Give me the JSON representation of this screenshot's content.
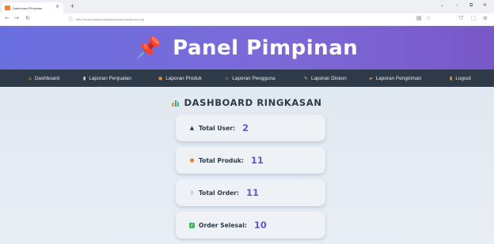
{
  "browser": {
    "tab_title": "Dashboard Pimpinan",
    "tab_close": "×",
    "new_tab": "+",
    "url": "http://localhost/riverakit/pimpinan/dashboard.php",
    "window_controls": [
      "⌄",
      "–",
      "⧉",
      "✕"
    ]
  },
  "header": {
    "title": "Panel Pimpinan",
    "pin_icon": "📌"
  },
  "navbar": {
    "items": [
      {
        "label": "Dashboard",
        "icon": "home-icon",
        "color": "#e0a93a"
      },
      {
        "label": "Laporan Penjualan",
        "icon": "document-icon",
        "color": "#d8dde3"
      },
      {
        "label": "Laporan Produk",
        "icon": "box-icon",
        "color": "#e08a3a"
      },
      {
        "label": "Laporan Pengguna",
        "icon": "users-icon",
        "color": "#4a5568"
      },
      {
        "label": "Laporan Diskon",
        "icon": "tag-icon",
        "color": "#e8c84a"
      },
      {
        "label": "Laporan Pengiriman",
        "icon": "truck-icon",
        "color": "#e08a3a"
      },
      {
        "label": "Logout",
        "icon": "door-icon",
        "color": "#e0a93a"
      }
    ]
  },
  "dashboard": {
    "title": "DASHBOARD RINGKASAN",
    "cards": [
      {
        "label": "Total User:",
        "value": "2",
        "icon": "user-icon"
      },
      {
        "label": "Total Produk:",
        "value": "11",
        "icon": "cookie-icon"
      },
      {
        "label": "Total Order:",
        "value": "11",
        "icon": "receipt-icon"
      },
      {
        "label": "Order Selesai:",
        "value": "10",
        "icon": "check-icon"
      }
    ]
  },
  "colors": {
    "header_gradient_start": "#6a6fe0",
    "header_gradient_end": "#7a58c8",
    "navbar": "#2f3a48",
    "value_accent": "#6a55c8"
  }
}
